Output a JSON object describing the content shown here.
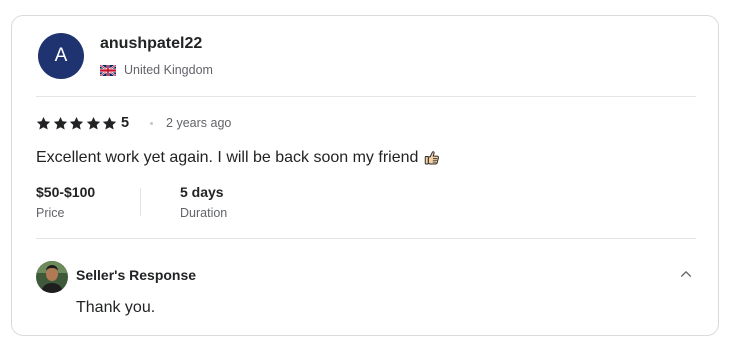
{
  "reviewer": {
    "avatar_initial": "A",
    "avatar_color": "#1f3370",
    "username": "anushpatel22",
    "country": "United Kingdom",
    "flag_icon": "uk-flag-icon"
  },
  "rating": {
    "stars": 5,
    "value": "5",
    "time_ago": "2 years ago"
  },
  "review": {
    "text": "Excellent work yet again. I will be back soon my friend",
    "emoji_icon": "thumbs-up-icon"
  },
  "meta": {
    "price_value": "$50-$100",
    "price_label": "Price",
    "duration_value": "5 days",
    "duration_label": "Duration"
  },
  "seller_response": {
    "title": "Seller's Response",
    "reply": "Thank you.",
    "toggle_icon": "chevron-up-icon"
  }
}
